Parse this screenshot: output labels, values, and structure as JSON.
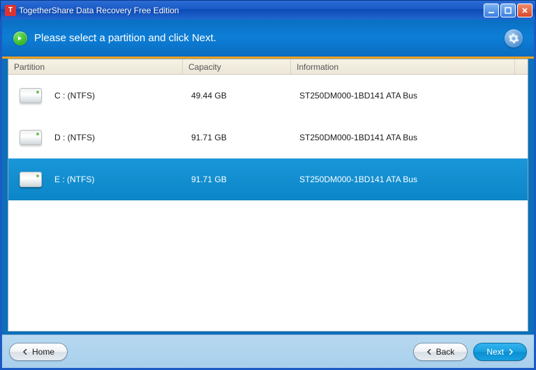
{
  "window": {
    "title": "TogetherShare Data Recovery Free Edition"
  },
  "header": {
    "instruction": "Please select a partition and click Next."
  },
  "columns": {
    "partition": "Partition",
    "capacity": "Capacity",
    "information": "Information"
  },
  "partitions": [
    {
      "name": "C :   (NTFS)",
      "capacity": "49.44 GB",
      "info": "ST250DM000-1BD141  ATA Bus",
      "selected": false
    },
    {
      "name": "D :   (NTFS)",
      "capacity": "91.71 GB",
      "info": "ST250DM000-1BD141  ATA Bus",
      "selected": false
    },
    {
      "name": "E :   (NTFS)",
      "capacity": "91.71 GB",
      "info": "ST250DM000-1BD141  ATA Bus",
      "selected": true
    }
  ],
  "buttons": {
    "home": "Home",
    "back": "Back",
    "next": "Next"
  }
}
